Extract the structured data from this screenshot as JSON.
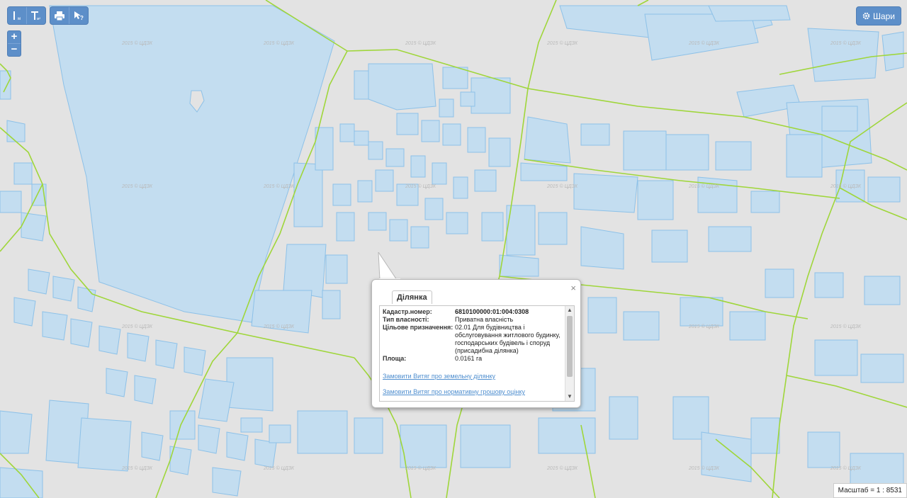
{
  "toolbar": {
    "measure_length_icon": "ruler-icon",
    "measure_area_icon": "area-ruler-icon",
    "print_icon": "print-icon",
    "info_icon": "identify-cursor-icon",
    "layers_label": "Шари",
    "layers_icon": "gear-icon",
    "zoom_in": "+",
    "zoom_out": "−"
  },
  "watermark_text": "2015 © ЦДЗК",
  "popup": {
    "tab": "Ділянка",
    "close": "×",
    "fields": [
      {
        "key": "Кадастр.номер:",
        "value": "6810100000:01:004:0308",
        "bold": true
      },
      {
        "key": "Тип власності:",
        "value": "Приватна власність"
      },
      {
        "key": "Цільове призначення:",
        "value": "02.01 Для будівництва і обслуговування житлового будинку, господарських будівель і споруд (присадибна ділянка)"
      },
      {
        "key": "Площа:",
        "value": "0.0161 га"
      }
    ],
    "links": [
      "Замовити Витяг про земельну ділянку",
      "Замовити Витяг про нормативну грошову оцінку"
    ]
  },
  "scale": "Масштаб = 1 : 8531",
  "colors": {
    "background": "#e3e3e3",
    "parcel_fill": "#c3ddf0",
    "parcel_stroke": "#8dc1e8",
    "boundary": "#9fd63a",
    "button": "#5d8fc9"
  }
}
